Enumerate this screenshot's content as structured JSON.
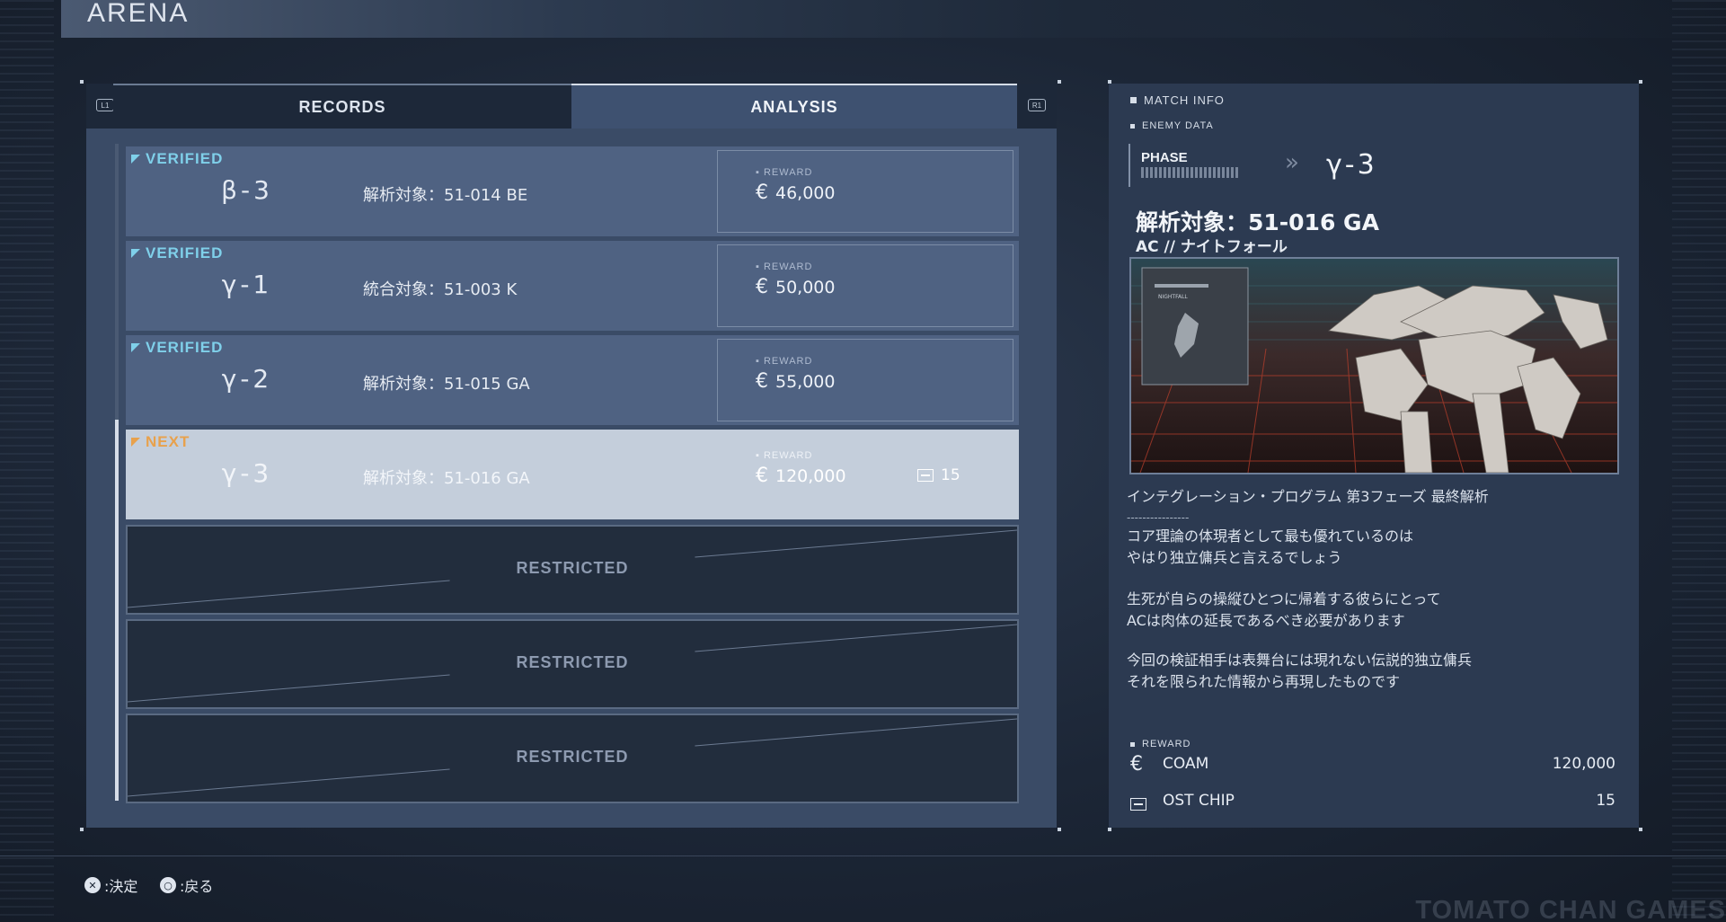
{
  "header": {
    "title": "ARENA"
  },
  "tabs": {
    "left_hint": "L1",
    "right_hint": "R1",
    "records": "RECORDS",
    "analysis": "ANALYSIS"
  },
  "rows": [
    {
      "status": "VERIFIED",
      "phase": "β-3",
      "target": "解析対象：51-014 BE",
      "reward_label": "REWARD",
      "reward_icon": "€",
      "reward": "46,000"
    },
    {
      "status": "VERIFIED",
      "phase": "γ-1",
      "target": "統合対象：51-003 K",
      "reward_label": "REWARD",
      "reward_icon": "€",
      "reward": "50,000"
    },
    {
      "status": "VERIFIED",
      "phase": "γ-2",
      "target": "解析対象：51-015 GA",
      "reward_label": "REWARD",
      "reward_icon": "€",
      "reward": "55,000"
    },
    {
      "status": "NEXT",
      "phase": "γ-3",
      "target": "解析対象：51-016 GA",
      "reward_label": "REWARD",
      "reward_icon": "€",
      "reward": "120,000",
      "chip": "15"
    }
  ],
  "restricted": [
    "RESTRICTED",
    "RESTRICTED",
    "RESTRICTED"
  ],
  "match_info": {
    "title": "MATCH INFO",
    "enemy_data": "ENEMY DATA",
    "phase_label": "PHASE",
    "phase_value": "γ-3",
    "chevron": "»",
    "target": "解析対象：51-016 GA",
    "ac_name": "AC // ナイトフォール",
    "image_card_title": "NIGHTFALL",
    "description": [
      "インテグレーション・プログラム 第3フェーズ 最終解析",
      "----------------",
      "コア理論の体現者として最も優れているのは",
      "やはり独立傭兵と言えるでしょう",
      "",
      "生死が自らの操縦ひとつに帰着する彼らにとって",
      "ACは肉体の延長であるべき必要があります",
      "",
      "今回の検証相手は表舞台には現れない伝説的独立傭兵",
      "それを限られた情報から再現したものです"
    ],
    "reward_label": "REWARD",
    "rewards": [
      {
        "icon": "€",
        "name": "COAM",
        "amount": "120,000"
      },
      {
        "icon": "chip-icon",
        "name": "OST CHIP",
        "amount": "15"
      }
    ]
  },
  "footer": {
    "confirm_icon": "✕",
    "confirm": ":決定",
    "back_icon": "○",
    "back": ":戻る"
  },
  "watermark": "TOMATO CHAN GAMES",
  "colors": {
    "verified": "#7fd0ea",
    "next": "#e8a14c"
  }
}
